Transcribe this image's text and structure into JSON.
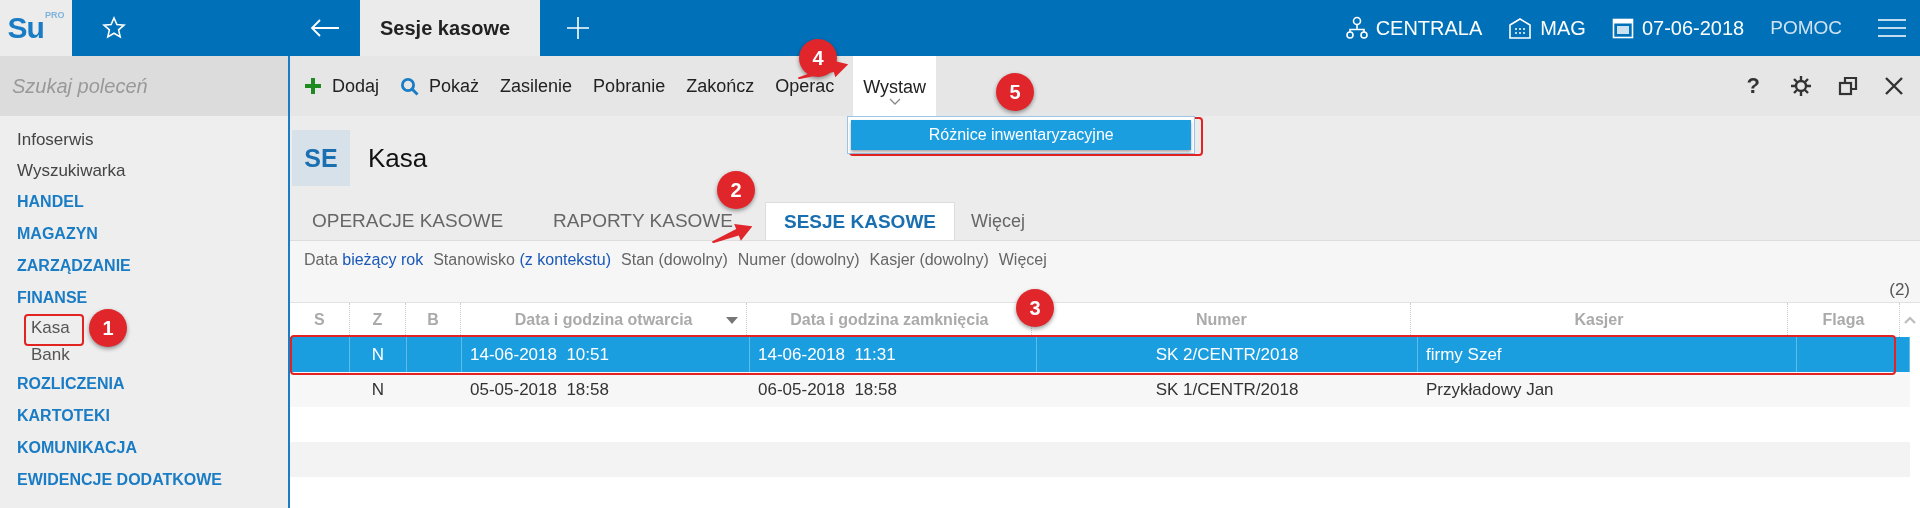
{
  "app": {
    "logo": "Su",
    "logo_badge": "PRO"
  },
  "top_bar": {
    "tab": "Sesje kasowe",
    "items": [
      {
        "kind": "network",
        "label": "CENTRALA"
      },
      {
        "kind": "building",
        "label": "MAG"
      },
      {
        "kind": "calendar",
        "label": "07-06-2018"
      },
      {
        "kind": "plain",
        "label": "POMOC"
      }
    ]
  },
  "sidebar": {
    "search_placeholder": "Szukaj poleceń",
    "items": [
      {
        "kind": "link",
        "label": "Infoserwis"
      },
      {
        "kind": "link",
        "label": "Wyszukiwarka"
      },
      {
        "kind": "section",
        "label": "HANDEL"
      },
      {
        "kind": "section",
        "label": "MAGAZYN"
      },
      {
        "kind": "section",
        "label": "ZARZĄDZANIE"
      },
      {
        "kind": "section",
        "label": "FINANSE",
        "children": [
          {
            "kind": "link",
            "label": "Kasa"
          },
          {
            "kind": "link",
            "label": "Bank"
          }
        ]
      },
      {
        "kind": "section",
        "label": "ROZLICZENIA"
      },
      {
        "kind": "section",
        "label": "KARTOTEKI"
      },
      {
        "kind": "section",
        "label": "KOMUNIKACJA"
      },
      {
        "kind": "section",
        "label": "EWIDENCJE DODATKOWE"
      }
    ]
  },
  "toolbar": {
    "buttons": [
      {
        "kind": "add",
        "label": "Dodaj"
      },
      {
        "kind": "search",
        "label": "Pokaż"
      },
      {
        "kind": "text",
        "label": "Zasilenie"
      },
      {
        "kind": "text",
        "label": "Pobranie"
      },
      {
        "kind": "text",
        "label": "Zakończ"
      },
      {
        "kind": "text",
        "label": "Operac"
      },
      {
        "kind": "menu",
        "label": "Wystaw",
        "expanded": true,
        "menu_items": [
          {
            "label": "Różnice inwentaryzacyjne",
            "selected": true
          }
        ]
      }
    ],
    "help": "?"
  },
  "module": {
    "badge": "SE",
    "title": "Kasa"
  },
  "tabs": [
    {
      "label": "OPERACJE KASOWE",
      "selected": false
    },
    {
      "label": "RAPORTY KASOWE",
      "selected": false
    },
    {
      "label": "SESJE KASOWE",
      "selected": true
    },
    {
      "label": "Więcej",
      "selected": false
    }
  ],
  "filters": [
    {
      "label": "Data",
      "value": "bieżący rok"
    },
    {
      "label": "Stanowisko",
      "value": "(z kontekstu)"
    },
    {
      "label": "Stan (dowolny)"
    },
    {
      "label": "Numer (dowolny)"
    },
    {
      "label": "Kasjer (dowolny)"
    },
    {
      "label": "Więcej"
    }
  ],
  "count": "(2)",
  "table": {
    "columns": [
      {
        "label": "S"
      },
      {
        "label": "Z"
      },
      {
        "label": "B"
      },
      {
        "label": "Data i godzina otwarcia",
        "sorted": true
      },
      {
        "label": "Data i godzina zamknięcia"
      },
      {
        "label": "Numer"
      },
      {
        "label": "Kasjer"
      },
      {
        "label": "Flaga"
      }
    ],
    "rows": [
      {
        "selected": true,
        "z": "N",
        "opened": "14-06-2018  10:51",
        "closed": "14-06-2018  11:31",
        "number": "SK 2/CENTR/2018",
        "cashier": "firmy Szef"
      },
      {
        "selected": false,
        "z": "N",
        "opened": "05-05-2018  18:58",
        "closed": "06-05-2018  18:58",
        "number": "SK 1/CENTR/2018",
        "cashier": "Przykładowy Jan"
      }
    ]
  },
  "callouts": [
    {
      "label": "1"
    },
    {
      "label": "2"
    },
    {
      "label": "3"
    },
    {
      "label": "4"
    },
    {
      "label": "5"
    }
  ]
}
